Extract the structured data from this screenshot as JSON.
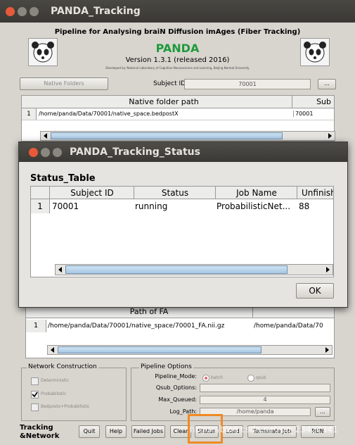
{
  "window": {
    "title": "PANDA_Tracking"
  },
  "header": {
    "pipeline_title": "Pipeline for Analysing braiN Diffusion imAges (Fiber Tracking)",
    "app_name": "PANDA",
    "version": "Version 1.3.1 (released 2016)",
    "developer_line": "Developed by: National Laboratory of Cognitive Neuroscience and Learning, Beijing Normal University"
  },
  "native": {
    "button": "Native Folders",
    "subject_ids_label": "Subject IDs:",
    "subject_ids_value": "70001",
    "more_button": "...",
    "columns": [
      "Native folder path",
      "Sub"
    ],
    "rows": [
      {
        "num": "1",
        "path": "/home/panda/Data/70001/native_space.bedpostX",
        "sub": "70001"
      }
    ]
  },
  "status_dialog": {
    "title": "PANDA_Tracking_Status",
    "table_label": "Status_Table",
    "columns": [
      "Subject ID",
      "Status",
      "Job Name",
      "Unfinish"
    ],
    "rows": [
      {
        "num": "1",
        "subject": "70001",
        "status": "running",
        "job": "ProbabilisticNet...",
        "unfinished": "88"
      }
    ],
    "ok_button": "OK"
  },
  "fa": {
    "columns": [
      "Path of FA"
    ],
    "rows": [
      {
        "num": "1",
        "path": "/home/panda/Data/70001/native_space/70001_FA.nii.gz",
        "path2": "/home/panda/Data/70"
      }
    ]
  },
  "network": {
    "title": "Network Construction",
    "options": [
      "Deterministic",
      "Probabilistic",
      "Bedpostx+Probabilistic"
    ]
  },
  "pipeline": {
    "title": "Pipeline Options",
    "mode_label": "Pipeline_Mode:",
    "mode_options": [
      "batch",
      "qsub"
    ],
    "qsub_label": "Qsub_Options:",
    "qsub_value": "",
    "maxq_label": "Max_Queued:",
    "maxq_value": "4",
    "log_label": "Log_Path:",
    "log_value": "/home/panda",
    "log_more": "..."
  },
  "footer": {
    "mode_label_line1": "Tracking",
    "mode_label_line2": "&Network",
    "buttons": [
      "Quit",
      "Help",
      "Failed Jobs",
      "Clear",
      "Status",
      "Load",
      "Terminate Job",
      "RUN"
    ]
  },
  "watermark": "https://blog.csdn.net/qq_23427341",
  "colors": {
    "accent": "#1e9a3c",
    "highlight": "#f08a24"
  }
}
